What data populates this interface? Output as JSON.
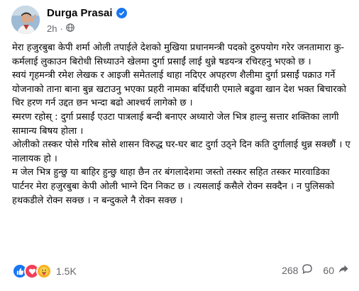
{
  "post": {
    "author": "Durga Prasai",
    "time": "2h",
    "paragraphs": [
      "मेरा हजुरबुबा केपी शर्मा ओली तपाईले देशको मुखिया प्रधानमन्त्री पदको दुरुपयोग गरेर जनतामारा कु-कर्मलाई लुकाउन बिरोधी सिध्याउने खेलमा दुर्गा प्रसाईं लाई थुन्ने षडयन्त्र रचिरहनु भएको छ ।",
      "स्वयं गृहमन्त्री रमेश लेखक र आइजी समेतलाई थाहा नदिएर अपहरण शैलीमा दुर्गा प्रसाईं पक्राउ गर्ने योजनाको ताना बाना बुन्न खटाउनु भएका प्रहरी नामका बर्दिधारी एमाले बढुवा खान देश भक्त बिचारको चिर हरण गर्न उद्दत छन भन्दा बढो आश्चर्य लागेको छ ।",
      "स्मरण रहोस् : दुर्गा प्रसाईं एउटा पात्रलाई बन्दी बनाएर अध्यारो जेल भित्र हाल्नु सत्तार शक्तिका लागी सामान्य बिषय होला ।",
      "ओलीको तस्कर पोसे गरिब सोसे शासन विरुद्ध घर-घर बाट दुर्गा उठ्ने दिन कति दुर्गालाई थुन्न सक्छौं । ए नालायक हो ।",
      "म जेल भित्र हुन्छु या बाहिर हुन्छु थाहा छैन तर बंगलादेशमा जस्तो तस्कर सहित तस्कर मारवाडिका पार्टनर मेरा हजुरबुबा केपी ओली भाग्ने दिन निकट छ । त्यसलाई कसैले रोक्न सक्दैन । न पुलिसको हथकडीले रोक्न सक्छ । न बन्दुकले नै रोक्न सक्छ ।"
    ]
  },
  "engagement": {
    "reaction_count": "1.5K",
    "comment_count": "268",
    "share_count": "60"
  },
  "colors": {
    "like": "#1877f2",
    "love": "#f33e58",
    "care": "#f7b125",
    "muted": "#65676b"
  },
  "icons": [
    "profile-avatar",
    "verified-badge-icon",
    "globe-icon",
    "like-icon",
    "love-icon",
    "care-icon",
    "comment-icon",
    "share-icon",
    "more-options-icon"
  ]
}
